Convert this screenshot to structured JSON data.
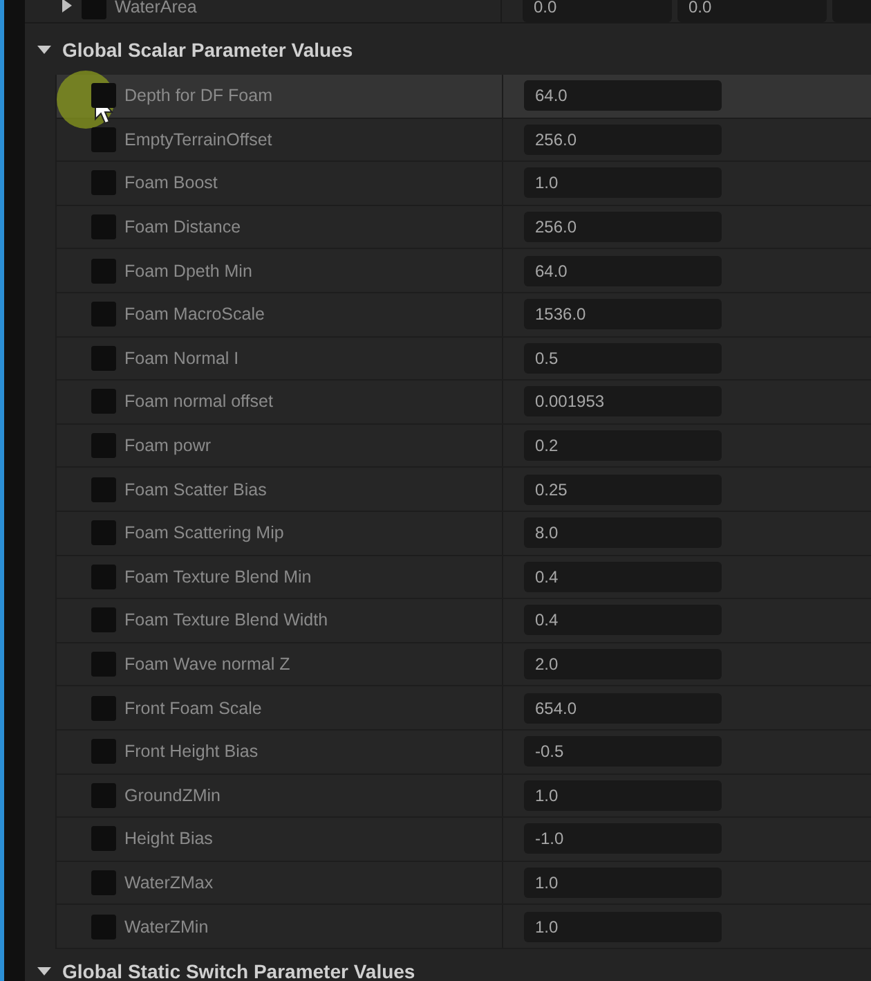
{
  "top_row": {
    "label": "WaterArea",
    "expanded": false,
    "checked": false,
    "values": [
      "0.0",
      "0.0"
    ]
  },
  "sections": [
    {
      "title": "Global Scalar Parameter Values",
      "expanded": true,
      "rows": [
        {
          "label": "Depth for DF Foam",
          "value": "64.0",
          "checked": false,
          "highlighted": true
        },
        {
          "label": "EmptyTerrainOffset",
          "value": "256.0",
          "checked": false,
          "highlighted": false
        },
        {
          "label": "Foam Boost",
          "value": "1.0",
          "checked": false,
          "highlighted": false
        },
        {
          "label": "Foam Distance",
          "value": "256.0",
          "checked": false,
          "highlighted": false
        },
        {
          "label": "Foam Dpeth Min",
          "value": "64.0",
          "checked": false,
          "highlighted": false
        },
        {
          "label": "Foam MacroScale",
          "value": "1536.0",
          "checked": false,
          "highlighted": false
        },
        {
          "label": "Foam Normal I",
          "value": "0.5",
          "checked": false,
          "highlighted": false
        },
        {
          "label": "Foam normal offset",
          "value": "0.001953",
          "checked": false,
          "highlighted": false
        },
        {
          "label": "Foam powr",
          "value": "0.2",
          "checked": false,
          "highlighted": false
        },
        {
          "label": "Foam Scatter Bias",
          "value": "0.25",
          "checked": false,
          "highlighted": false
        },
        {
          "label": "Foam Scattering Mip",
          "value": "8.0",
          "checked": false,
          "highlighted": false
        },
        {
          "label": "Foam Texture Blend Min",
          "value": "0.4",
          "checked": false,
          "highlighted": false
        },
        {
          "label": "Foam Texture Blend Width",
          "value": "0.4",
          "checked": false,
          "highlighted": false
        },
        {
          "label": "Foam Wave normal Z",
          "value": "2.0",
          "checked": false,
          "highlighted": false
        },
        {
          "label": "Front Foam Scale",
          "value": "654.0",
          "checked": false,
          "highlighted": false
        },
        {
          "label": "Front Height Bias",
          "value": "-0.5",
          "checked": false,
          "highlighted": false
        },
        {
          "label": "GroundZMin",
          "value": "1.0",
          "checked": false,
          "highlighted": false
        },
        {
          "label": "Height Bias",
          "value": "-1.0",
          "checked": false,
          "highlighted": false
        },
        {
          "label": "WaterZMax",
          "value": "1.0",
          "checked": false,
          "highlighted": false
        },
        {
          "label": "WaterZMin",
          "value": "1.0",
          "checked": false,
          "highlighted": false
        }
      ]
    },
    {
      "title": "Global Static Switch Parameter Values",
      "expanded": true
    }
  ]
}
